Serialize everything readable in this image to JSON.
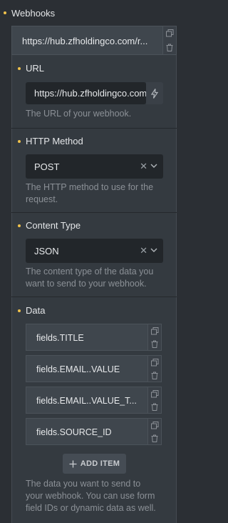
{
  "section": {
    "title": "Webhooks"
  },
  "webhook": {
    "header_url": "https://hub.zfholdingco.com/r..."
  },
  "url_field": {
    "label": "URL",
    "value": "https://hub.zfholdingco.com",
    "help": "The URL of your webhook."
  },
  "method_field": {
    "label": "HTTP Method",
    "value": "POST",
    "help_line1": "The HTTP method to use for the",
    "help_line2": "request."
  },
  "content_type_field": {
    "label": "Content Type",
    "value": "JSON",
    "help_line1": "The content type of the data you",
    "help_line2": "want to send to your webhook."
  },
  "data_field": {
    "label": "Data",
    "items": [
      "fields.TITLE",
      "fields.EMAIL..VALUE",
      "fields.EMAIL..VALUE_T...",
      "fields.SOURCE_ID"
    ],
    "add_label": "ADD ITEM",
    "help_line1": "The data you want to send to",
    "help_line2": "your webhook. You can use form",
    "help_line3": "field IDs or dynamic data as well."
  },
  "colors": {
    "accent": "#f0c24b",
    "background": "#2b2f34",
    "panel": "#343a40",
    "input": "#22262a"
  },
  "icons": [
    "copy-icon",
    "trash-icon",
    "bolt-icon",
    "clear-icon",
    "chevron-down-icon",
    "plus-icon"
  ]
}
